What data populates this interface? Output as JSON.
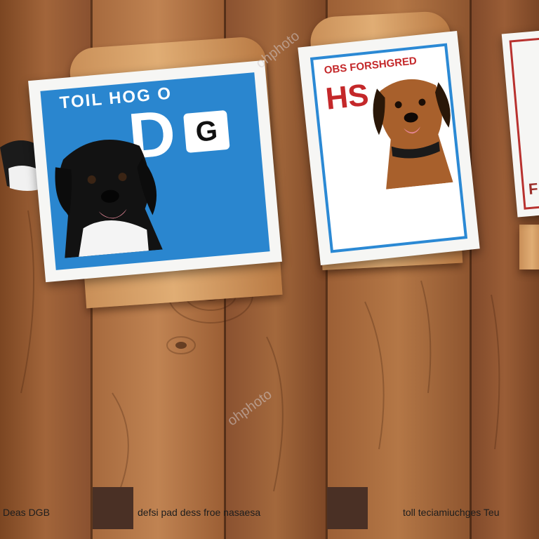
{
  "scene": {
    "table_colors": {
      "light": "#a8683c",
      "mid": "#8a5330",
      "dark": "#6b3b1d"
    },
    "stand_color": "#d29a60"
  },
  "sign_left": {
    "headline": "TOIL HOG O",
    "big_letters": "D",
    "badge_letter": "G",
    "background_color": "#2a86cf",
    "subject": "black-and-white dog"
  },
  "sign_middle": {
    "headline": "OBS FORSHGRED",
    "big_letters": "HS",
    "border_color": "#2b89d4",
    "subject": "brown dog"
  },
  "sign_right": {
    "letter": "F",
    "border_color": "#b8322f"
  },
  "watermarks": [
    "ohphoto",
    "ohphoto"
  ],
  "captions": {
    "left": "Deas DGB",
    "middle": "defsi pad dess froe nasaesa",
    "right": "toll teciamiuchges Teu"
  },
  "swatch_color": "#4a3025"
}
